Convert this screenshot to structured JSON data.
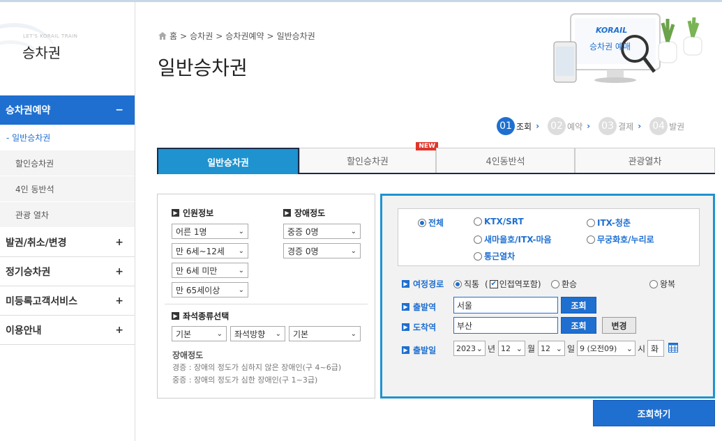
{
  "sidebar": {
    "slogan": "LET'S KORAIL TRAIN",
    "title": "승차권",
    "active_menu": {
      "label": "승차권예약",
      "toggle": "−"
    },
    "sub_items": [
      {
        "label": "- 일반승차권"
      },
      {
        "label": "할인승차권"
      },
      {
        "label": "4인 동반석"
      },
      {
        "label": "관광 열차"
      }
    ],
    "menus": [
      {
        "label": "발권/취소/변경",
        "toggle": "+"
      },
      {
        "label": "정기승차권",
        "toggle": "+"
      },
      {
        "label": "미등록고객서비스",
        "toggle": "+"
      },
      {
        "label": "이용안내",
        "toggle": "+"
      }
    ]
  },
  "breadcrumb": [
    "홈",
    "승차권",
    "승차권예약",
    "일반승차권"
  ],
  "breadcrumb_sep": ">",
  "page_title": "일반승차권",
  "promo": {
    "logo": "KORAIL",
    "text": "승차권 예매"
  },
  "steps": [
    {
      "num": "01",
      "label": "조회"
    },
    {
      "num": "02",
      "label": "예약"
    },
    {
      "num": "03",
      "label": "결제"
    },
    {
      "num": "04",
      "label": "발권"
    }
  ],
  "step_arrow": "›",
  "tabs": [
    {
      "label": "일반승차권"
    },
    {
      "label": "할인승차권",
      "badge": "NEW"
    },
    {
      "label": "4인동반석"
    },
    {
      "label": "관광열차"
    }
  ],
  "passenger": {
    "title": "인원정보",
    "selects": [
      "어른 1명",
      "만 6세~12세",
      "만 6세 미만",
      "만 65세이상"
    ]
  },
  "disability": {
    "title": "장애정도",
    "selects": [
      "중증 0명",
      "경증 0명"
    ]
  },
  "seat": {
    "title": "좌석종류선택",
    "selects": [
      "기본",
      "좌석방향",
      "기본"
    ]
  },
  "notes": {
    "title": "장애정도",
    "lines": [
      "경증 : 장애의 정도가 심하지 않은 장애인(구 4~6급)",
      "중증 : 장애의 정도가 심한 장애인(구 1~3급)"
    ]
  },
  "train_types": [
    "전체",
    "KTX/SRT",
    "ITX-청춘",
    "새마을호/ITX-마음",
    "무궁화호/누리로",
    "통근열차"
  ],
  "route": {
    "label": "여정경로",
    "direct": "직통",
    "nearby_open": "(",
    "nearby": "인접역포함)",
    "transfer": "환승",
    "round": "왕복"
  },
  "departure": {
    "label": "출발역",
    "value": "서울",
    "button": "조회"
  },
  "arrival": {
    "label": "도착역",
    "value": "부산",
    "button": "조회"
  },
  "swap_button": "변경",
  "date": {
    "label": "출발일",
    "year": "2023",
    "year_unit": "년",
    "month": "12",
    "month_unit": "월",
    "day": "12",
    "day_unit": "일",
    "time": "9 (오전09)",
    "time_unit": "시",
    "weekday": "화"
  },
  "search_button": "조회하기",
  "colors": {
    "brand": "#1e6fd0",
    "accent": "#1e93d0",
    "badge": "#e0352b"
  }
}
